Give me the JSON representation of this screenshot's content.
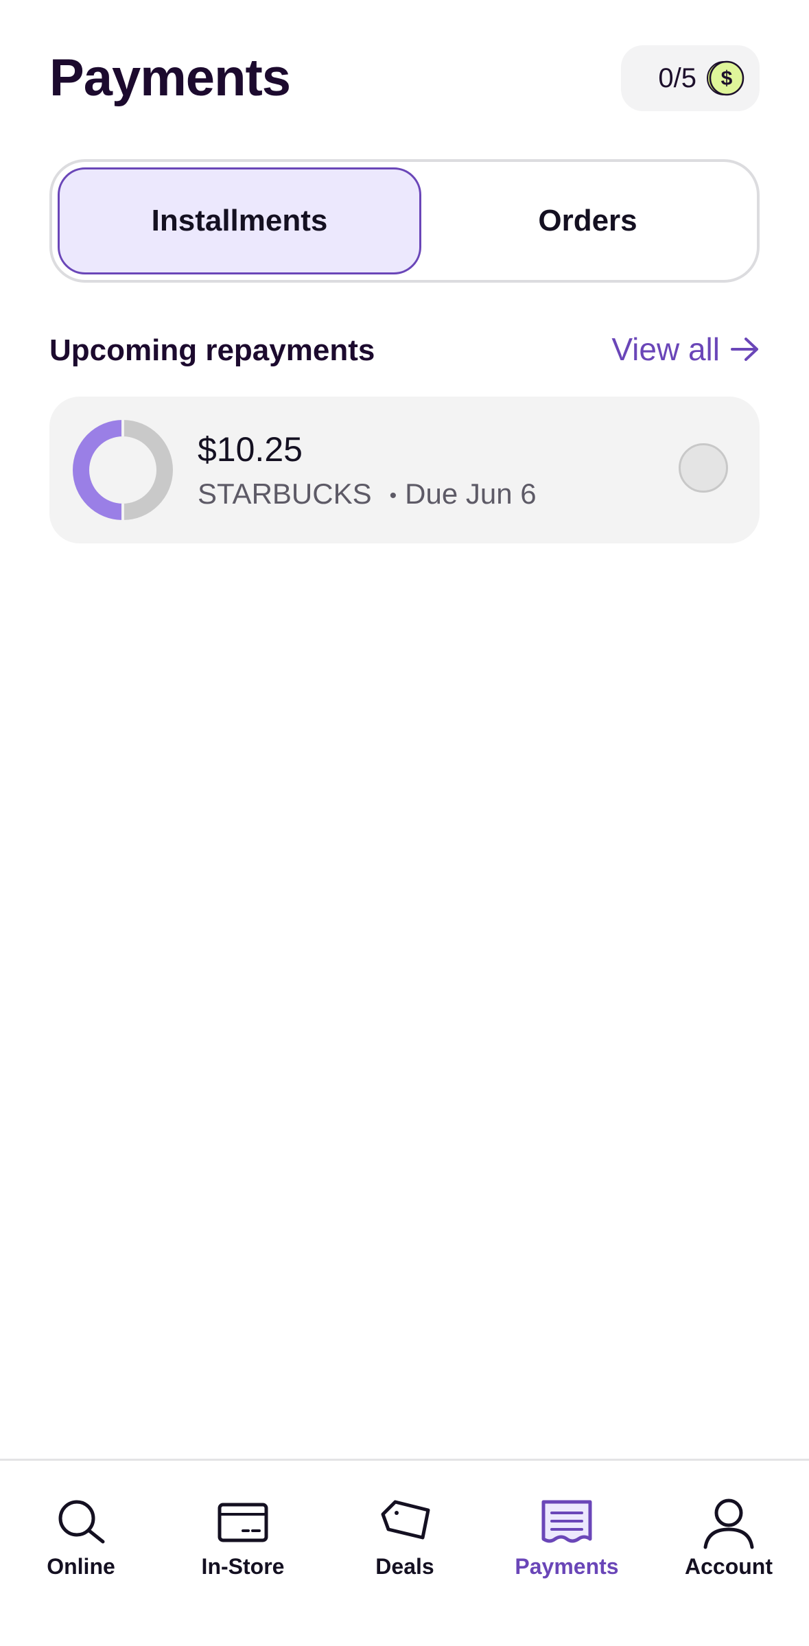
{
  "header": {
    "title": "Payments",
    "points_text": "0/5"
  },
  "tabs": [
    {
      "label": "Installments",
      "active": true
    },
    {
      "label": "Orders",
      "active": false
    }
  ],
  "upcoming": {
    "title": "Upcoming repayments",
    "view_all_label": "View all",
    "items": [
      {
        "amount": "$10.25",
        "merchant": "STARBUCKS",
        "due": "Due Jun 6",
        "progress_paid_fraction": 0.5
      }
    ]
  },
  "bottom_nav": [
    {
      "label": "Online",
      "icon": "search-icon",
      "active": false
    },
    {
      "label": "In-Store",
      "icon": "card-icon",
      "active": false
    },
    {
      "label": "Deals",
      "icon": "tag-icon",
      "active": false
    },
    {
      "label": "Payments",
      "icon": "receipt-icon",
      "active": true
    },
    {
      "label": "Account",
      "icon": "person-icon",
      "active": false
    }
  ],
  "colors": {
    "accent": "#6a46b8",
    "accent_light": "#ece8fd",
    "donut_paid": "#9a7fe6",
    "donut_remaining": "#c9c9c9",
    "coin": "#dff59a"
  }
}
